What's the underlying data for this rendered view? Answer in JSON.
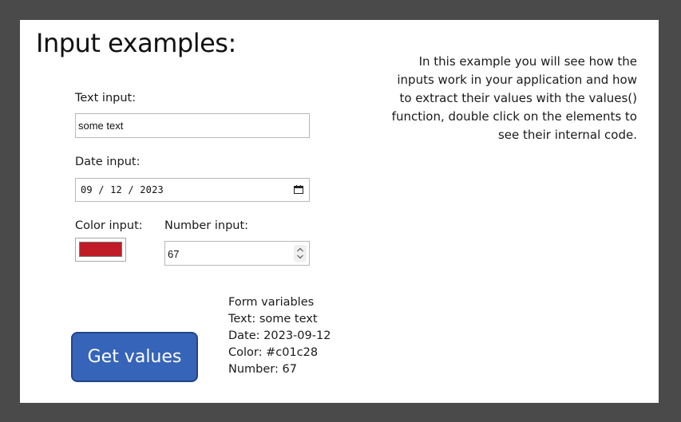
{
  "heading": "Input examples:",
  "description": "In this example you will see how the inputs work in your application and how to extract their values with the values() function, double click on the elements to see their internal code.",
  "form": {
    "text_label": "Text input:",
    "text_value": "some text",
    "date_label": "Date input:",
    "date_value": "09 / 12 / 2023",
    "color_label": "Color input:",
    "color_value": "#c01c28",
    "number_label": "Number input:",
    "number_value": "67"
  },
  "button": {
    "label": "Get values"
  },
  "results": {
    "header": "Form variables",
    "text_line": "Text: some text",
    "date_line": "Date: 2023-09-12",
    "color_line": "Color: #c01c28",
    "number_line": "Number: 67"
  },
  "icons": {
    "date": "calendar-icon",
    "number": "spinner-arrows-icon"
  }
}
